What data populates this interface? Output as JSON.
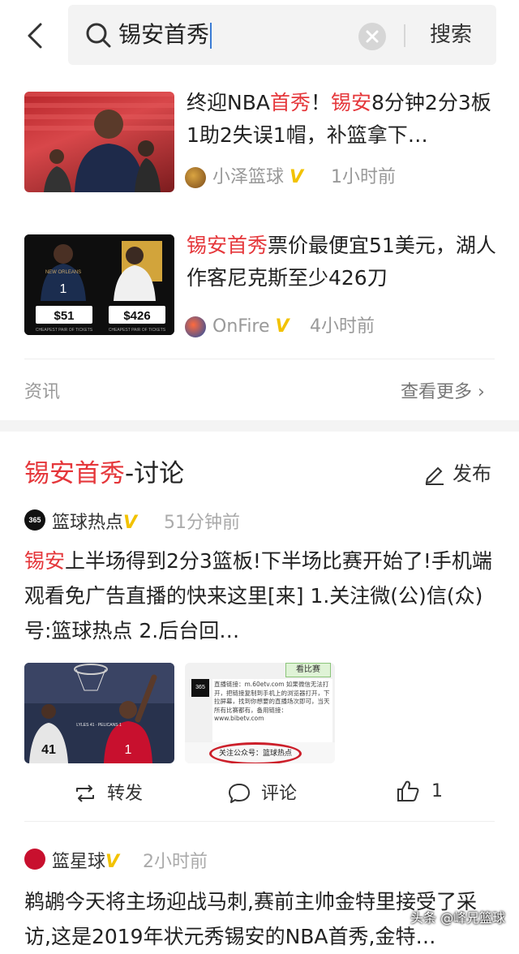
{
  "search": {
    "query": "锡安首秀",
    "button_label": "搜索"
  },
  "news": [
    {
      "title": [
        "终迎NBA",
        "首秀",
        "！",
        "锡安",
        "8分钟2分3板1助2失误1帽，补篮拿下…"
      ],
      "source": "小泽篮球",
      "time": "1小时前"
    },
    {
      "title": [
        "锡安首秀",
        "票价最便宜51美元，湖人作客尼克斯至少426刀"
      ],
      "source": "OnFire",
      "time": "4小时前",
      "prices": [
        "$51",
        "$426"
      ],
      "caption": "CHEAPEST PAIR OF TICKETS",
      "jersey": "NEW ORLEANS"
    }
  ],
  "news_section": {
    "label": "资讯",
    "more": "查看更多 ›"
  },
  "discussion": {
    "title_hl": "锡安首秀",
    "title_rest": "-讨论",
    "publish_label": "发布",
    "posts": [
      {
        "user": "篮球热点",
        "time": "51分钟前",
        "text_hl": "锡安",
        "text_rest": "上半场得到2分3篮板!下半场比赛开始了!手机端观看免广告直播的快来这里[来] 1.关注微(公)信(众)号:篮球热点 2.后台回…",
        "img2_tag": "看比赛",
        "img2_text": "直播链接：m.60etv.com 如果微信无法打开，把链接复制到手机上的浏览器打开，下拉屏幕，找到你想要的直播场次即可，当天所有比赛都有，备用链接：www.bibetv.com",
        "img2_highlight": "关注公众号：篮球热点",
        "img1_text": "LYLES 41 · PELICANS 1",
        "actions": {
          "repost": "转发",
          "comment": "评论",
          "like": "1"
        }
      },
      {
        "user": "篮星球",
        "time": "2小时前",
        "text": "鹈鹕今天将主场迎战马刺,赛前主帅金特里接受了采访,这是2019年状元秀锡安的NBA首秀,金特…"
      }
    ]
  },
  "watermark": "头条 @峰兄篮球",
  "colors": {
    "highlight": "#e5373b",
    "verified": "#f2c200"
  }
}
